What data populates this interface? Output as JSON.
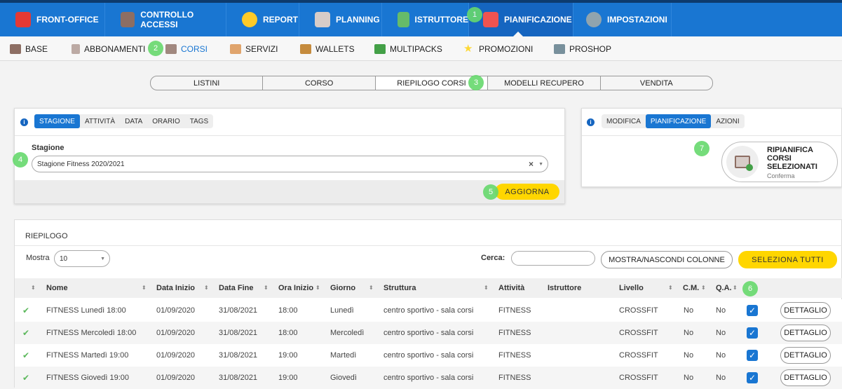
{
  "topnav": [
    {
      "label": "FRONT-OFFICE",
      "icon": "person-icon",
      "color": "#e53935"
    },
    {
      "label": "CONTROLLO ACCESSI",
      "icon": "turnstile-icon",
      "color": "#8d6e63"
    },
    {
      "label": "REPORT",
      "icon": "pie-chart-icon",
      "color": "#ffca28"
    },
    {
      "label": "PLANNING",
      "icon": "calendar-grid-icon",
      "color": "#d7ccc8"
    },
    {
      "label": "ISTRUTTORE",
      "icon": "instructor-icon",
      "color": "#66bb6a"
    },
    {
      "label": "PIANIFICAZIONE",
      "icon": "calendar-icon",
      "color": "#ef5350"
    },
    {
      "label": "IMPOSTAZIONI",
      "icon": "gear-icon",
      "color": "#90a4ae"
    }
  ],
  "subnav": [
    {
      "label": "BASE",
      "icon": "box-icon",
      "color": "#8d6e63"
    },
    {
      "label": "ABBONAMENTI",
      "icon": "clipboard-icon",
      "color": "#bcaaa4"
    },
    {
      "label": "CORSI",
      "icon": "shoe-icon",
      "color": "#a1887f"
    },
    {
      "label": "SERVIZI",
      "icon": "handshake-icon",
      "color": "#e0a46c"
    },
    {
      "label": "WALLETS",
      "icon": "wallet-icon",
      "color": "#c58b3d"
    },
    {
      "label": "MULTIPACKS",
      "icon": "cubes-icon",
      "color": "#43a047"
    },
    {
      "label": "PROMOZIONI",
      "icon": "star-icon",
      "color": "#fdd835"
    },
    {
      "label": "PROSHOP",
      "icon": "register-icon",
      "color": "#78909c"
    }
  ],
  "segments": [
    "LISTINI",
    "CORSO",
    "RIEPILOGO CORSI",
    "MODELLI RECUPERO",
    "VENDITA"
  ],
  "badges": [
    "1",
    "2",
    "3",
    "4",
    "5",
    "6",
    "7"
  ],
  "filter": {
    "tabs": [
      "STAGIONE",
      "ATTIVITÀ",
      "DATA",
      "ORARIO",
      "TAGS"
    ],
    "field_label": "Stagione",
    "field_value": "Stagione Fitness 2020/2021",
    "update_button": "AGGIORNA",
    "info": "i"
  },
  "actions": {
    "tabs": [
      "MODIFICA",
      "PIANIFICAZIONE",
      "AZIONI"
    ],
    "card_title_1": "RIPIANIFICA",
    "card_title_2": "CORSI",
    "card_title_3": "SELEZIONATI",
    "card_sub": "Conferma",
    "info": "i"
  },
  "summary": {
    "title": "RIEPILOGO",
    "show_label": "Mostra",
    "show_value": "10",
    "search_label": "Cerca:",
    "search_value": "",
    "toggle_columns": "MOSTRA/NASCONDI COLONNE",
    "select_all": "SELEZIONA TUTTI",
    "sort_glyph": "⬍",
    "headers": [
      "Nome",
      "Data Inizio",
      "Data Fine",
      "Ora Inizio",
      "Giorno",
      "Struttura",
      "Attività",
      "Istruttore",
      "Livello",
      "C.M.",
      "Q.A."
    ],
    "rows": [
      {
        "check": "✔",
        "nome": "FITNESS Lunedì 18:00",
        "inizio": "01/09/2020",
        "fine": "31/08/2021",
        "ora": "18:00",
        "giorno": "Lunedì",
        "struttura": "centro sportivo - sala corsi",
        "attivita": "FITNESS",
        "istruttore": "",
        "livello": "CROSSFIT",
        "cm": "No",
        "qa": "No",
        "selected": "✓",
        "detail": "DETTAGLIO"
      },
      {
        "check": "✔",
        "nome": "FITNESS Mercoledì 18:00",
        "inizio": "01/09/2020",
        "fine": "31/08/2021",
        "ora": "18:00",
        "giorno": "Mercoledì",
        "struttura": "centro sportivo - sala corsi",
        "attivita": "FITNESS",
        "istruttore": "",
        "livello": "CROSSFIT",
        "cm": "No",
        "qa": "No",
        "selected": "✓",
        "detail": "DETTAGLIO"
      },
      {
        "check": "✔",
        "nome": "FITNESS Martedì 19:00",
        "inizio": "01/09/2020",
        "fine": "31/08/2021",
        "ora": "19:00",
        "giorno": "Martedì",
        "struttura": "centro sportivo - sala corsi",
        "attivita": "FITNESS",
        "istruttore": "",
        "livello": "CROSSFIT",
        "cm": "No",
        "qa": "No",
        "selected": "✓",
        "detail": "DETTAGLIO"
      },
      {
        "check": "✔",
        "nome": "FITNESS Giovedì 19:00",
        "inizio": "01/09/2020",
        "fine": "31/08/2021",
        "ora": "19:00",
        "giorno": "Giovedì",
        "struttura": "centro sportivo - sala corsi",
        "attivita": "FITNESS",
        "istruttore": "",
        "livello": "CROSSFIT",
        "cm": "No",
        "qa": "No",
        "selected": "✓",
        "detail": "DETTAGLIO"
      }
    ]
  },
  "colors": {
    "primary": "#1976d2",
    "accent": "#ffd600",
    "badge": "#67d96d",
    "check": "#5cb85c"
  }
}
